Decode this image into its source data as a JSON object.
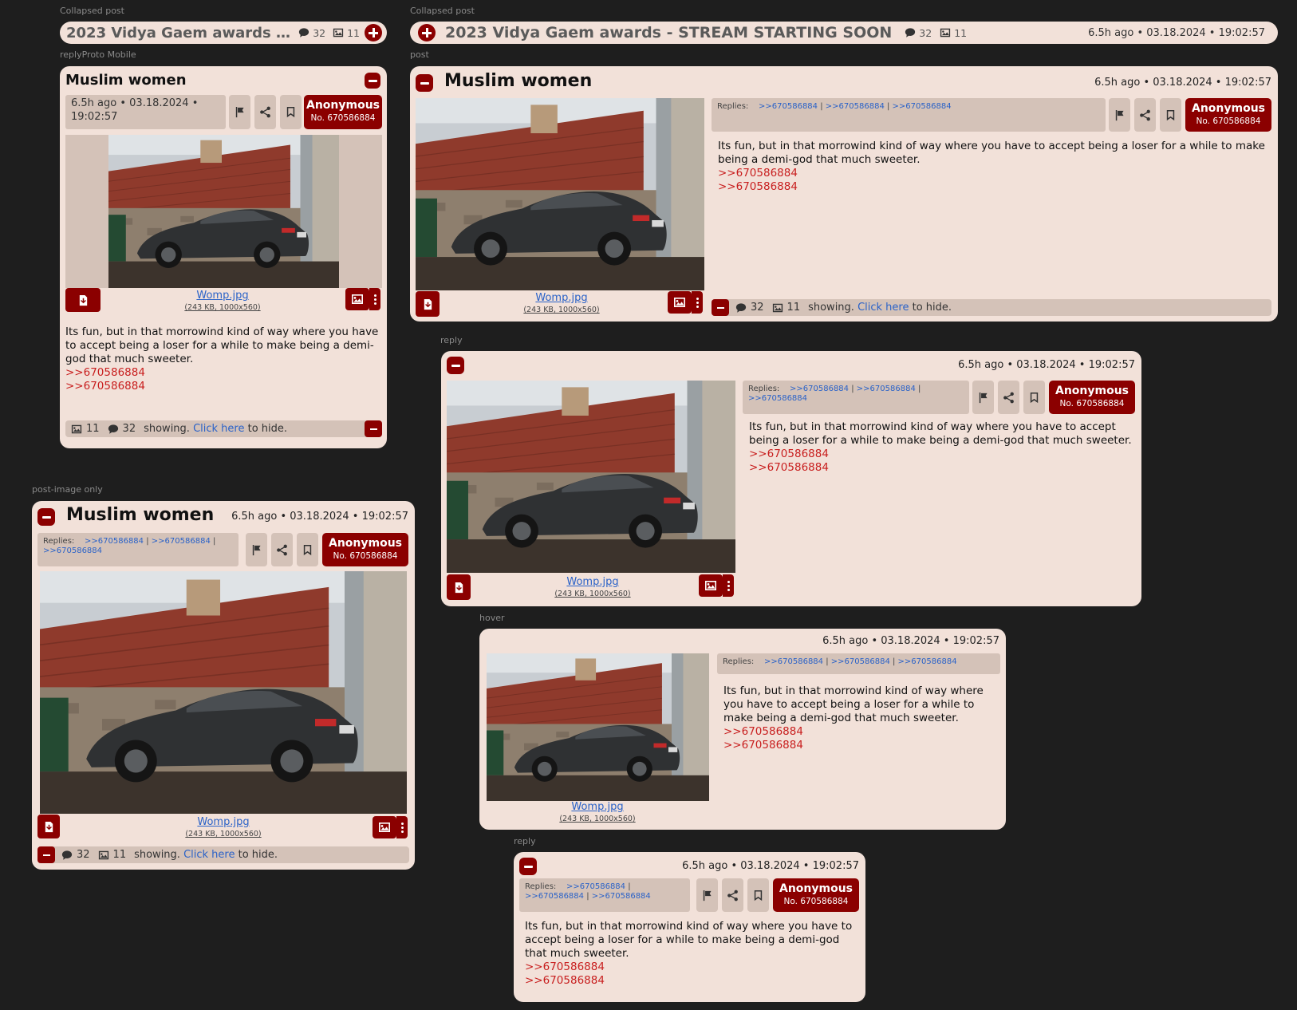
{
  "labels": {
    "collapsed": "Collapsed post",
    "mobile": "replyProto Mobile",
    "post": "post",
    "reply": "reply",
    "imageonly": "post-image only",
    "hover": "hover"
  },
  "thread": {
    "title": "2023 Vidya Gaem awards - STREAM STARTING SOON",
    "title_truncated": "2023 Vidya Gaem awards - STRE...",
    "post_title": "Muslim women",
    "replies": "32",
    "images": "11",
    "time": "6.5h ago • 03.18.2024 • 19:02:57",
    "time_l1": "6.5h ago • 03.18.2024 •",
    "time_l2": "19:02:57"
  },
  "post": {
    "author": "Anonymous",
    "number": "No. 670586884",
    "replies_label": "Replies:",
    "reply_link": ">>670586884",
    "sep": " | ",
    "text": "Its fun, but in that morrowind kind of way where you have to accept being a loser for a while to make being a demi-god that much sweeter.",
    "quote": ">>670586884",
    "file_name": "Womp.jpg",
    "file_info": "(243 KB, 1000x560)"
  },
  "footer": {
    "showing": "showing.",
    "click": "Click here",
    "tail": "to hide."
  },
  "icons": {
    "comment": "comment-icon",
    "image": "image-icon",
    "flag": "flag-icon",
    "share": "share-icon",
    "bookmark": "bookmark-icon",
    "download": "download-icon",
    "menu": "kebab-menu-icon",
    "collapse": "minus-icon",
    "expand": "plus-icon"
  },
  "colors": {
    "accent": "#8b0000",
    "card": "#f2e1d9",
    "meta": "#d4c2b8",
    "link": "#2a62c8",
    "quote": "#c81e1e",
    "background": "#1e1e1e"
  }
}
